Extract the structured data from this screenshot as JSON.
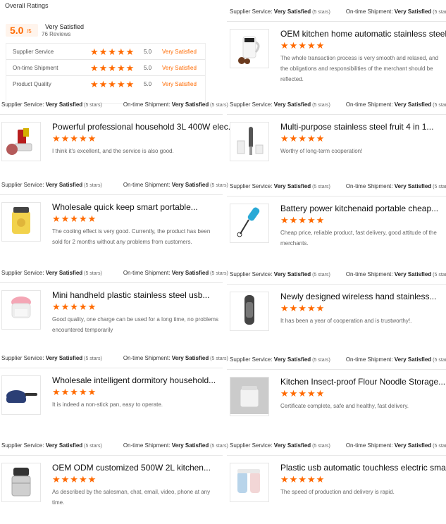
{
  "overall": {
    "title": "Overall Ratings",
    "score": "5.0",
    "score_suffix": "/5",
    "label": "Very Satisfied",
    "reviews": "76 Reviews",
    "rows": [
      {
        "name": "Supplier Service",
        "value": "5.0",
        "label": "Very Satisfied",
        "stars": 5
      },
      {
        "name": "On-time Shipment",
        "value": "5.0",
        "label": "Very Satisfied",
        "stars": 5
      },
      {
        "name": "Product Quality",
        "value": "5.0",
        "label": "Very Satisfied",
        "stars": 5
      }
    ]
  },
  "common": {
    "supplier_service_label": "Supplier Service:",
    "on_time_label": "On-time Shipment:",
    "very_satisfied": "Very Satisfied",
    "stars_5": "(5 stars)"
  },
  "colors": {
    "accent": "#ff6a00",
    "muted": "#666666",
    "line": "#e6e6e6"
  },
  "reviews": [
    {
      "col": "right",
      "title": "OEM kitchen home automatic stainless steel...",
      "desc": "The whole transaction process is very smooth and relaxed, and the obligations and responsibilities of the merchant should be reflected.",
      "icon": "white-kettle-icon"
    },
    {
      "col": "left",
      "title": "Powerful professional household 3L 400W elec...",
      "desc": "I think it's excellent, and the service is also good.",
      "icon": "meat-grinder-icon"
    },
    {
      "col": "right",
      "title": "Multi-purpose stainless steel fruit 4 in 1...",
      "desc": "Worthy of long-term cooperation!",
      "icon": "hand-blender-set-icon"
    },
    {
      "col": "left",
      "title": "Wholesale quick keep smart portable...",
      "desc": "The cooling effect is very good. Currently, the product has been sold for 2 months without any problems from customers.",
      "icon": "portable-cooler-icon"
    },
    {
      "col": "right",
      "title": "Battery power kitchenaid portable cheap...",
      "desc": "Cheap price, reliable product, fast delivery, good attitude of the merchants.",
      "icon": "milk-frother-icon"
    },
    {
      "col": "left",
      "title": "Mini handheld plastic stainless steel usb...",
      "desc": "Good quality, one charge can be used for a long time, no problems encountered temporarily",
      "icon": "mini-chopper-icon"
    },
    {
      "col": "right",
      "title": "Newly designed wireless hand stainless...",
      "desc": "It has been a year of cooperation and is trustworthy!.",
      "icon": "thermos-bottle-icon"
    },
    {
      "col": "left",
      "title": "Wholesale intelligent dormitory household...",
      "desc": "It is indeed a non-stick pan, easy to operate.",
      "icon": "sauce-pan-icon"
    },
    {
      "col": "right",
      "title": "Kitchen Insect-proof Flour Noodle Storage...",
      "desc": "Certificate complete, safe and healthy, fast delivery.",
      "icon": "storage-container-icon"
    },
    {
      "col": "left",
      "title": "OEM ODM customized 500W 2L kitchen...",
      "desc": "As described by the salesman, chat, email, video, phone at any time.",
      "icon": "food-processor-icon"
    },
    {
      "col": "right",
      "title": "Plastic usb automatic touchless electric smart...",
      "desc": "The speed of production and delivery is rapid.",
      "icon": "smart-dispenser-icon"
    }
  ]
}
